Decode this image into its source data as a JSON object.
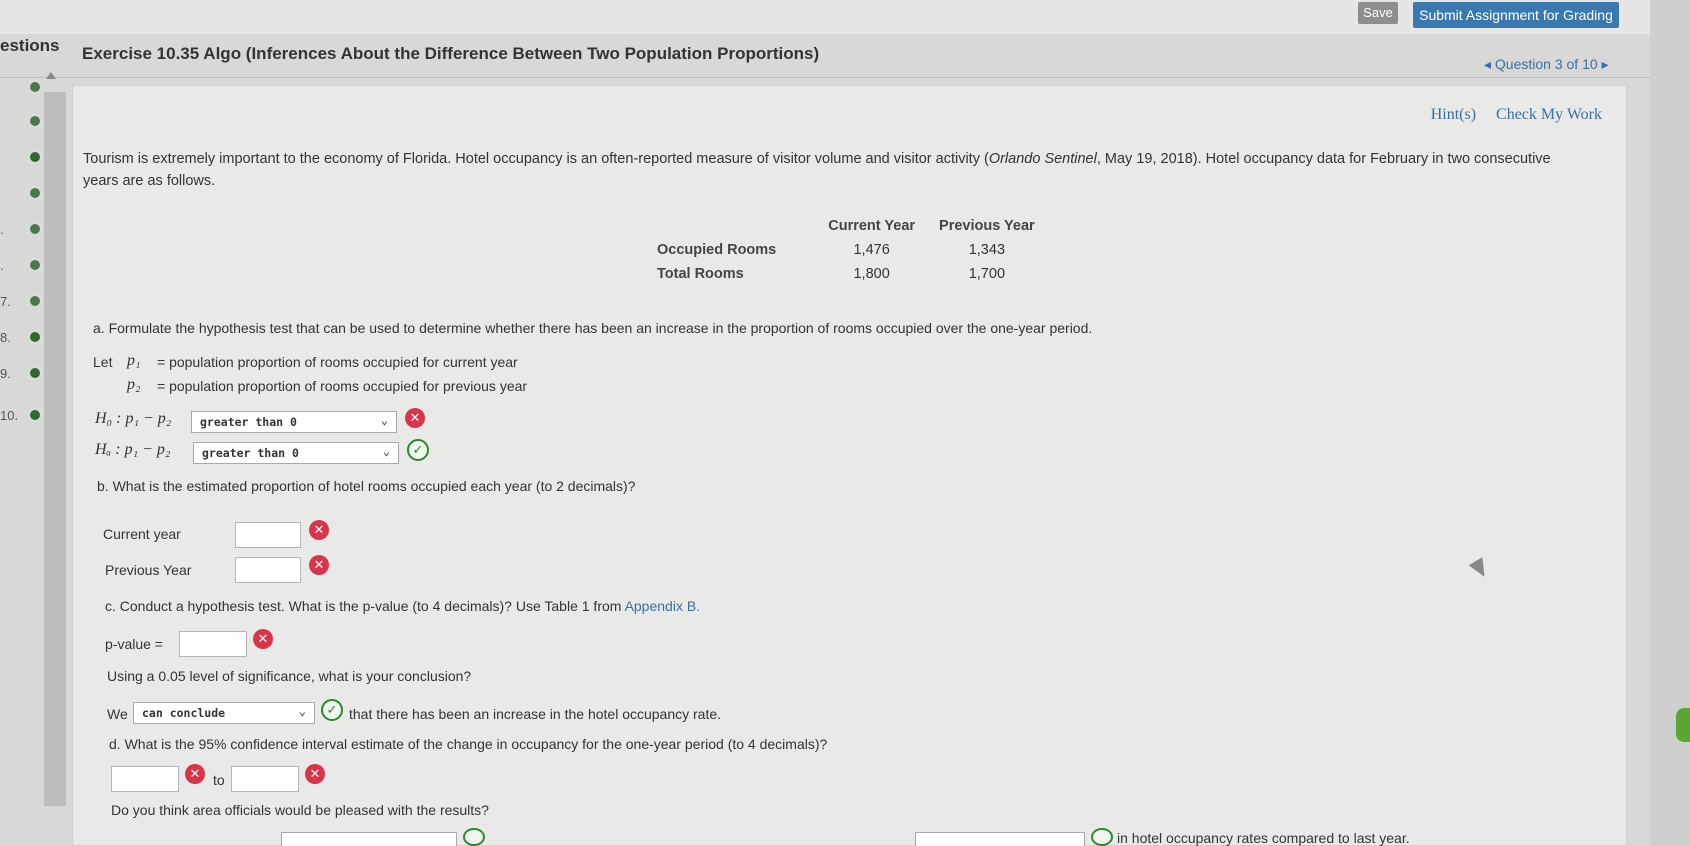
{
  "topbar": {
    "save_label": "Save",
    "submit_label": "Submit Assignment for Grading"
  },
  "header": {
    "questions_label": "estions",
    "title": "Exercise 10.35 Algo (Inferences About the Difference Between Two Population Proportions)",
    "nav": "◂ Question 3 of 10 ▸"
  },
  "sidebar": {
    "items": [
      {
        "num": ""
      },
      {
        "num": ""
      },
      {
        "num": ""
      },
      {
        "num": ""
      },
      {
        "num": "."
      },
      {
        "num": "."
      },
      {
        "num": "7."
      },
      {
        "num": "8."
      },
      {
        "num": "9."
      },
      {
        "num": "10."
      }
    ]
  },
  "hints": {
    "hint": "Hint(s)",
    "check": "Check My Work"
  },
  "intro": {
    "text_before": "Tourism is extremely important to the economy of Florida. Hotel occupancy is an often-reported measure of visitor volume and visitor activity (",
    "source": "Orlando Sentinel",
    "text_after": ", May 19, 2018). Hotel occupancy data for February in two consecutive years are as follows."
  },
  "table": {
    "headers": [
      "",
      "Current Year",
      "Previous Year"
    ],
    "rows": [
      {
        "label": "Occupied Rooms",
        "current": "1,476",
        "previous": "1,343"
      },
      {
        "label": "Total Rooms",
        "current": "1,800",
        "previous": "1,700"
      }
    ]
  },
  "part_a": {
    "prompt": "a. Formulate the hypothesis test that can be used to determine whether there has been an increase in the proportion of rooms occupied over the one-year period.",
    "let": "Let",
    "p1_sym": "p₁",
    "p1_def": "= population proportion of rooms occupied for current year",
    "p2_sym": "p₂",
    "p2_def": "= population proportion of rooms occupied for previous year",
    "h0_label": "H₀ : p₁ − p₂",
    "h0_value": "greater than 0",
    "ha_label": "Hₐ : p₁ − p₂",
    "ha_value": "greater than 0"
  },
  "part_b": {
    "prompt": "b. What is the estimated proportion of hotel rooms occupied each year (to 2 decimals)?",
    "current_label": "Current year",
    "previous_label": "Previous Year"
  },
  "part_c": {
    "prompt_start": "c. Conduct a hypothesis test. What is the p-value (to 4 decimals)? Use Table 1 from",
    "appendix": "Appendix B.",
    "pvalue_label": "p-value =",
    "conclusion_prompt": "Using a 0.05 level of significance, what is your conclusion?",
    "we": "We",
    "we_value": "can conclude",
    "we_after": "that there has been an increase in the hotel occupancy rate."
  },
  "part_d": {
    "prompt": "d. What is the 95% confidence interval estimate of the change in occupancy for the one-year period (to 4 decimals)?",
    "to": "to",
    "officials_prompt": "Do you think area officials would be pleased with the results?",
    "last_line_end": "in hotel occupancy rates compared to last year."
  }
}
